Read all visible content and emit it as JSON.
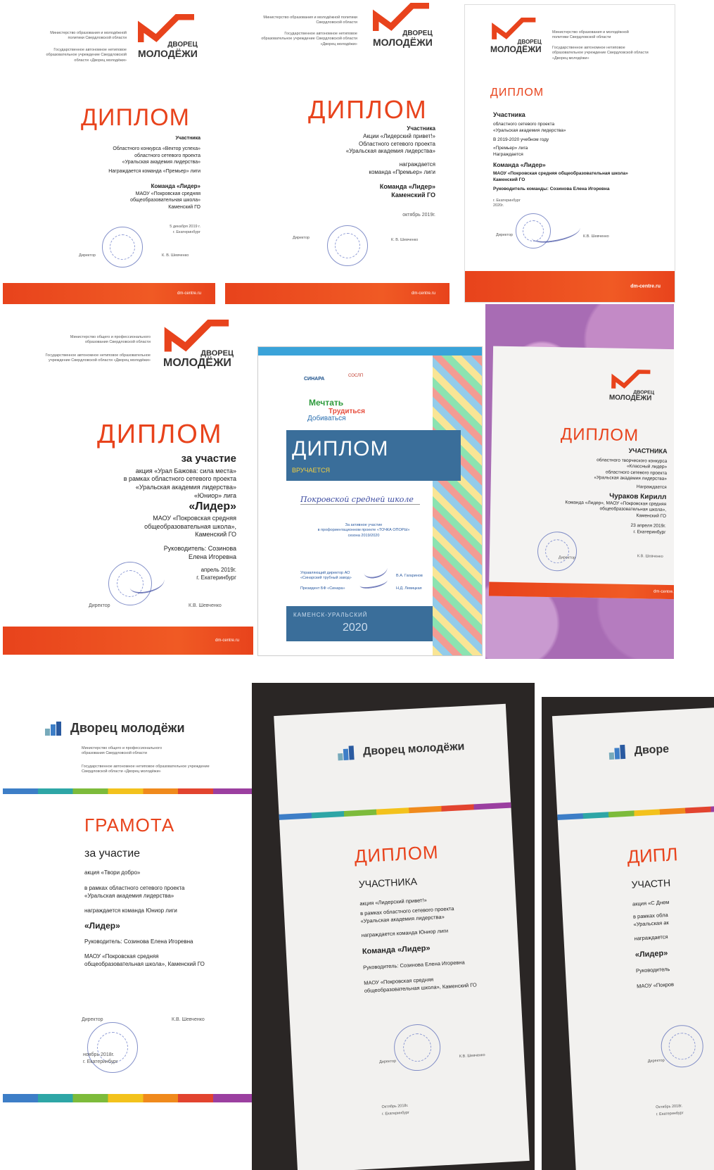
{
  "brand": {
    "logo_line1": "ДВОРЕЦ",
    "logo_line2": "МОЛОДЁЖИ",
    "logo_wide": "Дворец молодёжи",
    "site": "dm-centre.ru",
    "accent_color": "#e8431c"
  },
  "d1": {
    "ministry": "Министерство образования и молодёжной политики Свердловской области",
    "org": "Государственное автономное нетиповое образовательное учреждение Свердловской области «Дворец молодёжи»",
    "title": "ДИПЛОМ",
    "l1": "Участника",
    "l2": "Областного конкурса «Вектор успеха»",
    "l3": "областного сетевого проекта",
    "l4": "«Уральская академия лидерства»",
    "l5": "Награждается команда «Премьер» лиги",
    "l6": "Команда «Лидер»",
    "l7": "МАОУ «Покровская средняя",
    "l8": "общеобразовательная школа»",
    "l9": "Каменский ГО",
    "date": "5 декабря 2019 г.",
    "city": "г. Екатеринбург",
    "director": "Директор",
    "director_name": "К. В. Шевченко"
  },
  "d2": {
    "ministry": "Министерство образования и молодёжной политики Свердловской области",
    "org": "Государственное автономное нетиповое образовательное учреждение Свердловской области «Дворец молодёжи»",
    "title": "ДИПЛОМ",
    "l1": "Участника",
    "l2": "Акции «Лидерский привет!»",
    "l3": "Областного сетевого проекта",
    "l4": "«Уральская академия лидерства»",
    "l5": "награждается",
    "l6": "команда «Премьер» лиги",
    "l7": "Команда «Лидер»",
    "l8": "Каменский ГО",
    "date": "октябрь 2019г.",
    "director": "Директор",
    "director_name": "К. В. Шевченко"
  },
  "d3": {
    "ministry": "Министерство образования и молодёжной политики Свердловской области",
    "org": "Государственное автономное нетиповое образовательное учреждение Свердловской области «Дворец молодёжи»",
    "title": "ДИПЛОМ",
    "l1": "Участника",
    "l2": "областного сетевого проекта",
    "l3": "«Уральская академия лидерства»",
    "l4": "В 2019-2020 учебном году",
    "l5": "«Премьер» лига",
    "l6": "Награждается",
    "l7": "Команда «Лидер»",
    "l8": "МАОУ «Покровская средняя общеобразовательная школа»",
    "l9": "Каменский ГО",
    "l10": "Руководитель команды: Созинова Елена Игоревна",
    "city": "г. Екатеринбург",
    "year": "2020г.",
    "director": "Директор",
    "director_name": "К.В. Шевченко"
  },
  "d4": {
    "ministry": "Министерство общего и профессионального образования Свердловской области",
    "org": "Государственное автономное нетиповое образовательное учреждение Свердловской области «Дворец молодёжи»",
    "title": "ДИПЛОМ",
    "l1": "за участие",
    "l2": "акция «Урал Бажова: сила места»",
    "l3": "в рамках областного сетевого проекта",
    "l4": "«Уральская академия лидерства»",
    "l5": "«Юниор» лига",
    "l6": "«Лидер»",
    "l7": "МАОУ «Покровская средняя",
    "l8": "общеобразовательная школа»,",
    "l9": "Каменский ГО",
    "l10": "Руководитель: Созинова",
    "l11": "Елена Игоревна",
    "date": "апрель 2019г.",
    "city": "г. Екатеринбург",
    "director": "Директор",
    "director_name": "К.В. Шевченко"
  },
  "d5": {
    "sponsor1": "СИНАРА",
    "sponsor2": "СОСЛП",
    "m1": "Мечтать",
    "m2": "Трудиться",
    "m3": "Добиваться",
    "title": "ДИПЛОМ",
    "sub": "ВРУЧАЕТСЯ",
    "recipient": "Покровской средней школе",
    "l1": "За активное участие",
    "l2": "в профориентационном проекте «ТОЧКА ОПОРЫ»",
    "l3": "сезона 2019/2020",
    "s1": "Управляющий директор АО «Синарский трубный завод»",
    "s1name": "В.А. Гагаринов",
    "s2": "Президент БФ «Синара»",
    "s2name": "Н.Д. Левицкая",
    "city": "КАМЕНСК-УРАЛЬСКИЙ",
    "year": "2020"
  },
  "d6": {
    "title": "ДИПЛОМ",
    "l1": "УЧАСТНИКА",
    "l2": "областного творческого конкурса",
    "l3": "«Классный лидер»",
    "l4": "областного сетевого проекта",
    "l5": "«Уральская академия лидерства»",
    "l6": "Награждается",
    "l7": "Чураков Кирилл",
    "l8": "Команда «Лидер», МАОУ «Покровская средняя",
    "l9": "общеобразовательная школа»,",
    "l10": "Каменский ГО",
    "date": "23 апреля 2019г.",
    "city": "г. Екатеринбург",
    "director": "Директор",
    "director_name": "К.В. Шевченко"
  },
  "d7": {
    "ministry": "Министерство общего и профессионального образования Свердловской области",
    "org": "Государственное автономное нетиповое образовательное учреждение Свердловской области «Дворец молодёжи»",
    "title": "ГРАМОТА",
    "l1": "за участие",
    "l2": "акция «Твори добро»",
    "l3": "в рамках областного сетевого проекта",
    "l4": "«Уральская академия лидерства»",
    "l5": "награждается команда Юниор лиги",
    "l6": "«Лидер»",
    "l7": "Руководитель: Созинова Елена Игоревна",
    "l8": "МАОУ «Покровская средняя",
    "l9": "общеобразовательная школа», Каменский ГО",
    "director": "Директор",
    "director_name": "К.В. Шевченко",
    "date": "ноябрь 2018г.",
    "city": "г. Екатеринбург"
  },
  "d8": {
    "title": "ДИПЛОМ",
    "l1": "УЧАСТНИКА",
    "l2": "акция «Лидерский привет!»",
    "l3": "в рамках областного сетевого проекта",
    "l4": "«Уральская академия лидерства»",
    "l5": "награждается команда Юниор лиги",
    "l6": "Команда «Лидер»",
    "l7": "Руководитель: Созинова Елена Игоревна",
    "l8": "МАОУ «Покровская средняя",
    "l9": "общеобразовательная школа», Каменский ГО",
    "director": "Директор",
    "director_name": "К.В. Шевченко",
    "date": "Октябрь 2018г.",
    "city": "г. Екатеринбург"
  },
  "d9": {
    "logo": "Дворе",
    "title": "ДИПЛ",
    "l1": "УЧАСТН",
    "l2": "акция «С Днем",
    "l3": "в рамках обла",
    "l4": "«Уральская ак",
    "l5": "награждается",
    "l6": "«Лидер»",
    "l7": "Руководитель",
    "l8": "МАОУ «Покров",
    "director": "Директор",
    "date": "Октябрь 2018г.",
    "city": "г. Екатеринбург"
  }
}
